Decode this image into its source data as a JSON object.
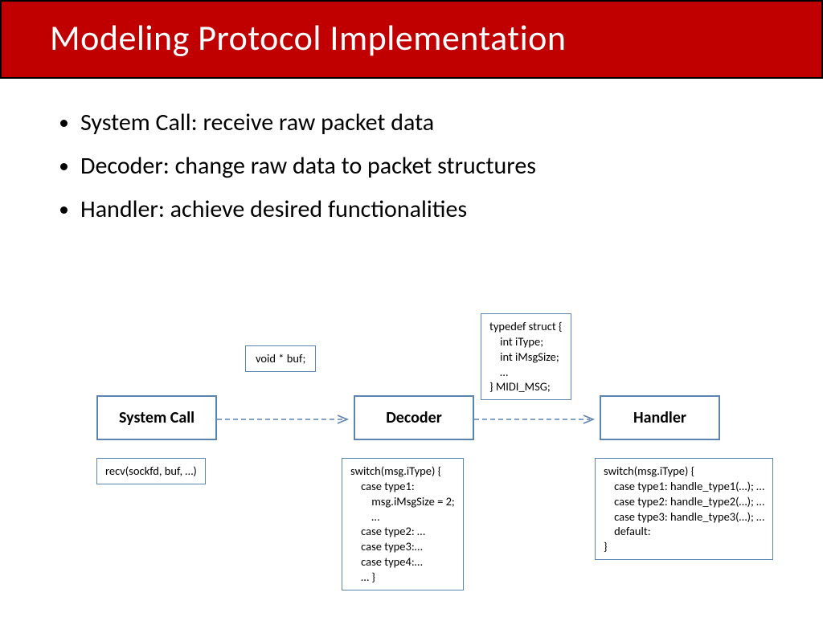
{
  "title": "Modeling Protocol Implementation",
  "bullets": [
    "System Call: receive raw packet data",
    "Decoder: change raw data to packet structures",
    "Handler: achieve desired functionalities"
  ],
  "diagram": {
    "nodes": {
      "system_call": "System Call",
      "decoder": "Decoder",
      "handler": "Handler"
    },
    "code_boxes": {
      "buf_decl": "void * buf;",
      "recv_call": "recv(sockfd, buf, …)",
      "struct_def": "typedef struct {\n    int iType;\n    int iMsgSize;\n    …\n} MIDI_MSG;",
      "decoder_switch": "switch(msg.iType) {\n    case type1:\n        msg.iMsgSize = 2;\n        …\n    case type2: …\n    case type3:…\n    case type4:…\n    … }",
      "handler_switch": "switch(msg.iType) {\n    case type1: handle_type1(…); …\n    case type2: handle_type2(…); …\n    case type3: handle_type3(…); …\n    default:\n}"
    }
  }
}
